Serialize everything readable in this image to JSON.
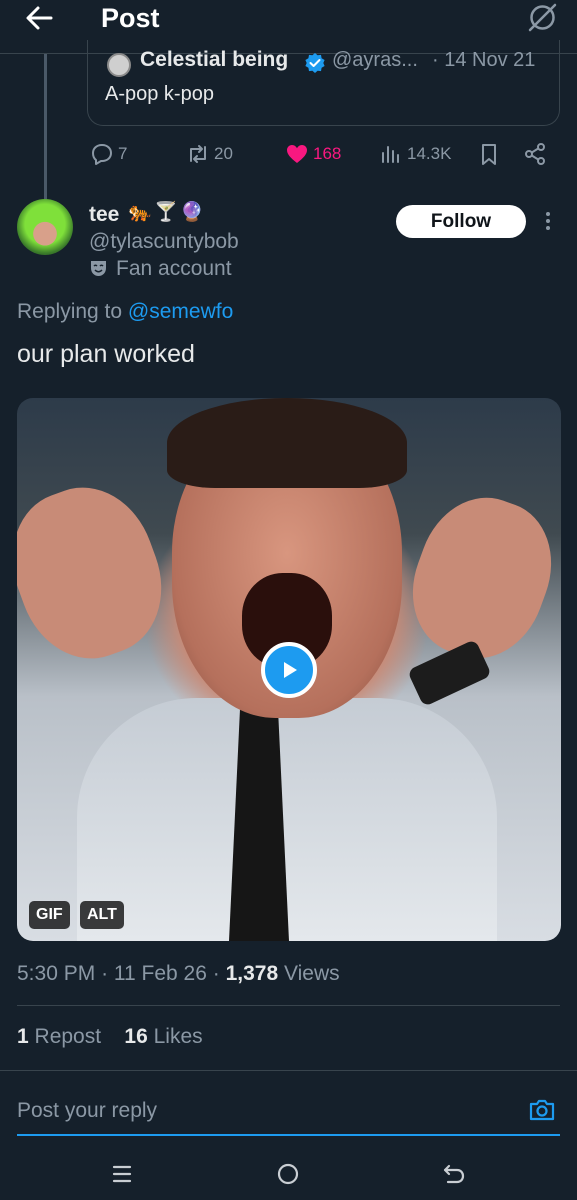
{
  "header": {
    "title": "Post",
    "back_icon": "arrow-left-icon",
    "grok_icon": "grok-slash-circle-icon"
  },
  "quoted_post": {
    "name": "Celestial being",
    "handle": "@ayras...",
    "date": "· 14 Nov 21",
    "text": "A-pop k-pop"
  },
  "actions": {
    "replies": "7",
    "reposts": "20",
    "likes": "168",
    "views": "14.3K",
    "like_color": "#f91880"
  },
  "post": {
    "author_name": "tee",
    "author_emoji": [
      "🐅",
      "🍸",
      "🔮"
    ],
    "handle": "@tylascuntybob",
    "account_label": "Fan account",
    "follow_label": "Follow",
    "replying_prefix": "Replying to",
    "replying_mention": "@semewfo",
    "text": "our plan worked",
    "media_badges": [
      "GIF",
      "ALT"
    ]
  },
  "meta": {
    "time": "5:30 PM",
    "date": "11 Feb 26",
    "views_count": "1,378",
    "views_label": "Views"
  },
  "stats": {
    "reposts_count": "1",
    "reposts_label": "Repost",
    "likes_count": "16",
    "likes_label": "Likes"
  },
  "reply": {
    "placeholder": "Post your reply"
  },
  "colors": {
    "background": "#15202b",
    "accent": "#1d9bf0",
    "muted": "#8b98a5",
    "border": "#38444d"
  }
}
